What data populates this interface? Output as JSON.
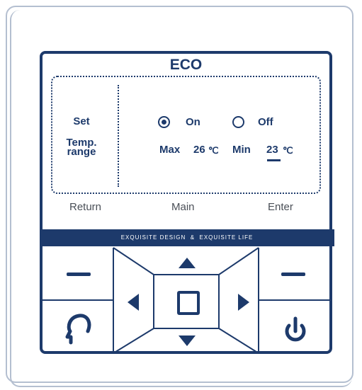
{
  "colors": {
    "navy": "#1d3a6b",
    "outline": "#b4bfd0",
    "gray": "#4a4f57"
  },
  "screen": {
    "title": "ECO",
    "left_label_line1": "Set",
    "left_label_line2": "Temp.",
    "left_label_line3": "range",
    "on_label": "On",
    "off_label": "Off",
    "mode_selected": "On",
    "max_label": "Max",
    "max_value": "26",
    "min_label": "Min",
    "min_value": "23",
    "unit": "℃"
  },
  "soft_keys": {
    "left": "Return",
    "middle": "Main",
    "right": "Enter"
  },
  "banner": {
    "text": "EXQUISITE DESIGN  &  EXQUISITE LIFE"
  },
  "buttons": {
    "minus_left_icon": "minus-icon",
    "minus_right_icon": "minus-icon",
    "up_icon": "arrow-up-icon",
    "down_icon": "arrow-down-icon",
    "left_icon": "arrow-left-icon",
    "right_icon": "arrow-right-icon",
    "center_icon": "square-icon",
    "return_icon": "head-icon",
    "power_icon": "power-icon"
  }
}
